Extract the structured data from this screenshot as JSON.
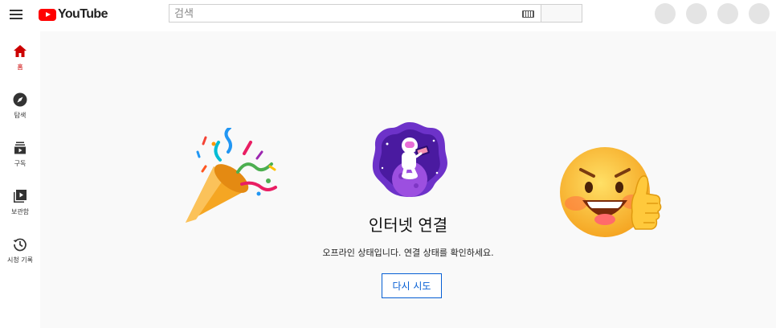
{
  "header": {
    "logo_text": "YouTube",
    "search_placeholder": "검색"
  },
  "sidebar": {
    "items": [
      {
        "label": "홈"
      },
      {
        "label": "탐색"
      },
      {
        "label": "구독"
      },
      {
        "label": "보관함"
      },
      {
        "label": "시청 기록"
      }
    ]
  },
  "offline": {
    "title": "인터넷 연결",
    "message": "오프라인 상태입니다. 연결 상태를 확인하세요.",
    "retry_label": "다시 시도"
  },
  "colors": {
    "brand_red": "#ff0000",
    "accent_blue": "#065fd4",
    "main_background": "#f9f9f9"
  }
}
